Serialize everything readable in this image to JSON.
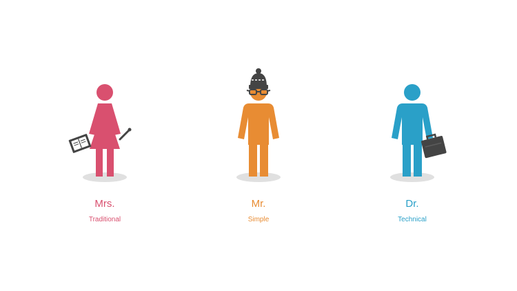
{
  "personas": [
    {
      "title": "Mrs.",
      "subtitle": "Traditional",
      "color": "#d9506f",
      "icon": "woman-with-tablet-and-pen"
    },
    {
      "title": "Mr.",
      "subtitle": "Simple",
      "color": "#e88c33",
      "icon": "man-with-beanie-and-glasses"
    },
    {
      "title": "Dr.",
      "subtitle": "Technical",
      "color": "#2aa0c8",
      "icon": "man-with-briefcase"
    }
  ],
  "colors": {
    "accessory": "#444444",
    "shadow": "#e0e0e0"
  }
}
